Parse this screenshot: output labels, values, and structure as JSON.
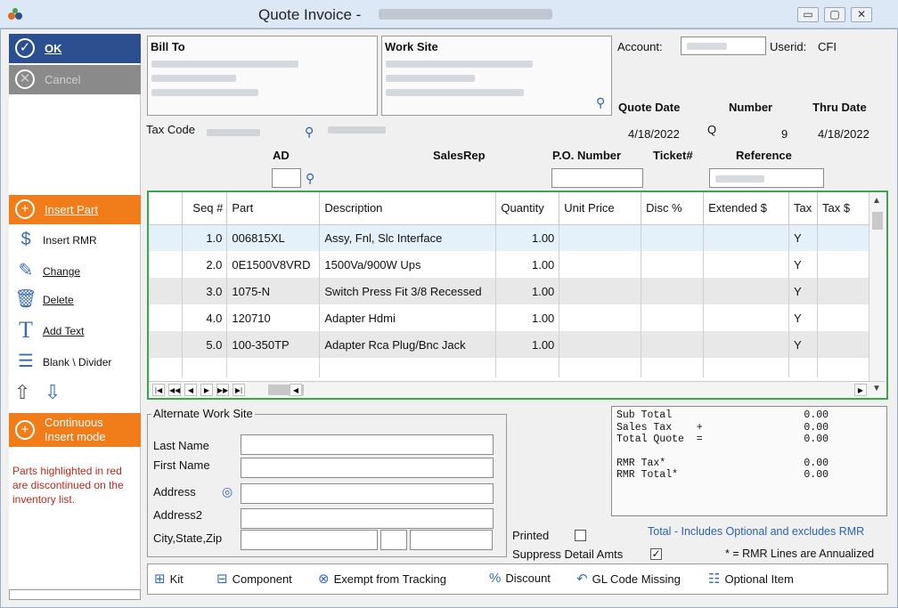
{
  "window": {
    "title": "Quote Invoice -",
    "minimize": "▭",
    "maximize": "▢",
    "close": "✕"
  },
  "sidebar": {
    "ok": "OK",
    "cancel": "Cancel",
    "insert_part": "Insert Part",
    "insert_rmr": "Insert RMR",
    "change": "Change",
    "delete": "Delete",
    "add_text": "Add Text",
    "blank_divider": "Blank \\ Divider",
    "continuous_line1": "Continuous",
    "continuous_line2": "Insert mode",
    "note": "Parts highlighted in red are discontinued on the inventory list."
  },
  "header": {
    "bill_to": "Bill To",
    "work_site": "Work Site",
    "account_label": "Account:",
    "userid_label": "Userid:",
    "userid_value": "CFI",
    "quote_date_label": "Quote Date",
    "number_label": "Number",
    "thru_date_label": "Thru Date",
    "quote_date": "4/18/2022",
    "number_prefix": "Q",
    "number_value": "9",
    "thru_date": "4/18/2022",
    "tax_code_label": "Tax Code",
    "ad_label": "AD",
    "salesrep_label": "SalesRep",
    "po_label": "P.O. Number",
    "ticket_label": "Ticket#",
    "reference_label": "Reference"
  },
  "grid": {
    "columns": [
      "Seq #",
      "Part",
      "Description",
      "Quantity",
      "Unit Price",
      "Disc %",
      "Extended $",
      "Tax",
      "Tax $"
    ],
    "rows": [
      {
        "seq": "1.0",
        "part": "006815XL",
        "desc": "Assy, Fnl, Slc Interface",
        "qty": "1.00",
        "tax": "Y"
      },
      {
        "seq": "2.0",
        "part": "0E1500V8VRD",
        "desc": "1500Va/900W  Ups",
        "qty": "1.00",
        "tax": "Y"
      },
      {
        "seq": "3.0",
        "part": "1075-N",
        "desc": "Switch Press Fit 3/8 Recessed",
        "qty": "1.00",
        "tax": "Y"
      },
      {
        "seq": "4.0",
        "part": "120710",
        "desc": "Adapter Hdmi",
        "qty": "1.00",
        "tax": "Y"
      },
      {
        "seq": "5.0",
        "part": "100-350TP",
        "desc": "Adapter Rca Plug/Bnc Jack",
        "qty": "1.00",
        "tax": "Y"
      }
    ]
  },
  "alt_site": {
    "legend": "Alternate Work Site",
    "last_name": "Last Name",
    "first_name": "First Name",
    "address": "Address",
    "address2": "Address2",
    "city_state_zip": "City,State,Zip"
  },
  "totals": {
    "sub_total": "Sub Total",
    "sales_tax": "Sales Tax    +",
    "total_quote": "Total Quote  =",
    "rmr_tax": "RMR Tax*",
    "rmr_total": "RMR Total*",
    "sub_total_val": "0.00",
    "sales_tax_val": "0.00",
    "total_quote_val": "0.00",
    "rmr_tax_val": "0.00",
    "rmr_total_val": "0.00",
    "note1": "Total - Includes Optional and excludes RMR",
    "note2": "* = RMR Lines are Annualized"
  },
  "flags": {
    "printed": "Printed",
    "suppress": "Suppress Detail Amts",
    "suppress_checked": "✓"
  },
  "legend_bar": {
    "kit": "Kit",
    "component": "Component",
    "exempt": "Exempt from Tracking",
    "discount": "Discount",
    "gl_missing": "GL Code Missing",
    "optional": "Optional Item"
  },
  "colors": {
    "accent_orange": "#f07d1a",
    "ok_blue": "#2c4f8f",
    "grid_border": "#3aa64a",
    "note_red": "#c0261a",
    "link_blue": "#2a62b5"
  }
}
